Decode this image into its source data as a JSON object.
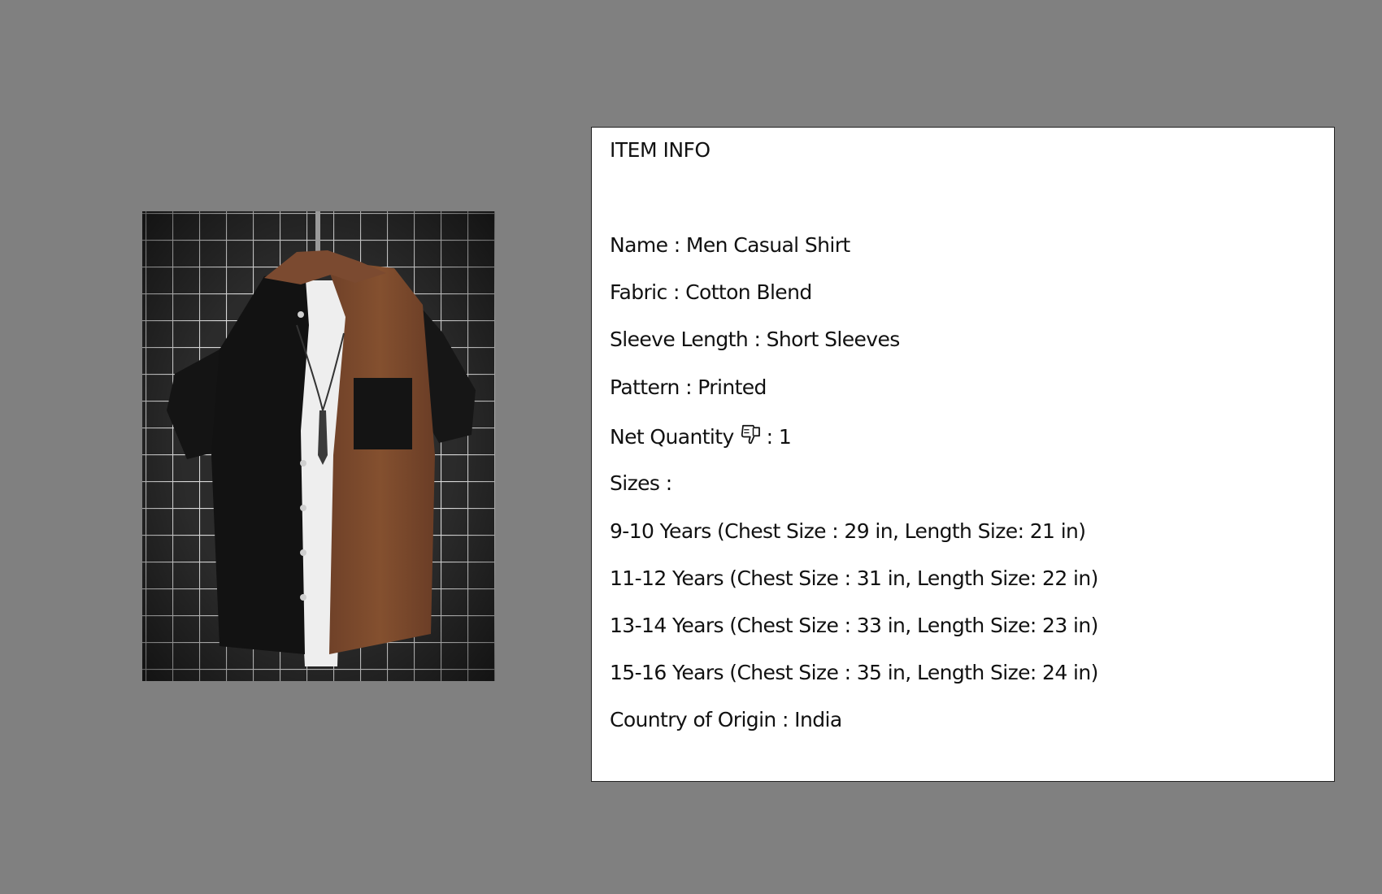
{
  "product": {
    "image_alt": "Men casual shirt with black and brown panels hanging on a wall"
  },
  "item_info": {
    "heading": "ITEM INFO",
    "name": "Name : Men Casual Shirt",
    "fabric": "Fabric : Cotton Blend",
    "sleeve_length": "Sleeve Length : Short Sleeves",
    "pattern": "Pattern : Printed",
    "net_quantity_label": "Net Quantity",
    "net_quantity_icon": "thumbs-down-icon",
    "net_quantity_value": ": 1",
    "sizes_label": "Sizes :",
    "sizes": [
      "9-10 Years (Chest Size : 29 in, Length Size: 21 in)",
      "11-12 Years (Chest Size : 31 in, Length Size: 22 in)",
      "13-14 Years (Chest Size : 33 in, Length Size: 23 in)",
      "15-16 Years (Chest Size : 35 in, Length Size: 24 in)"
    ],
    "country_of_origin": "Country of Origin : India"
  },
  "colors": {
    "background": "#808080",
    "panel": "#ffffff",
    "shirt_black": "#161616",
    "shirt_brown": "#7a4a30"
  }
}
